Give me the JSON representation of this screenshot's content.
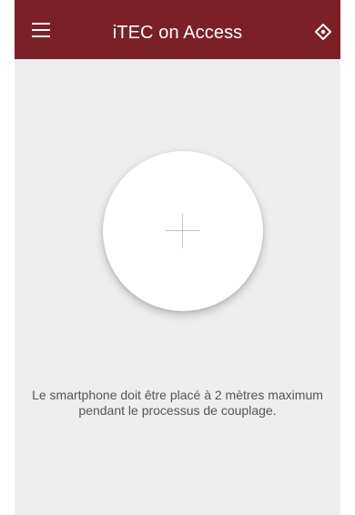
{
  "app_bar": {
    "title": "iTEC on Access",
    "background_color": "#7b2027",
    "left_icon": "hamburger-menu-icon",
    "right_icon": "scan-target-icon"
  },
  "main": {
    "background_color": "#eeeeee",
    "pair_button_icon": "plus-icon",
    "instruction_line_1": "Le smartphone doit être placé à 2 mètres maximum",
    "instruction_line_2": "pendant le processus de couplage."
  }
}
